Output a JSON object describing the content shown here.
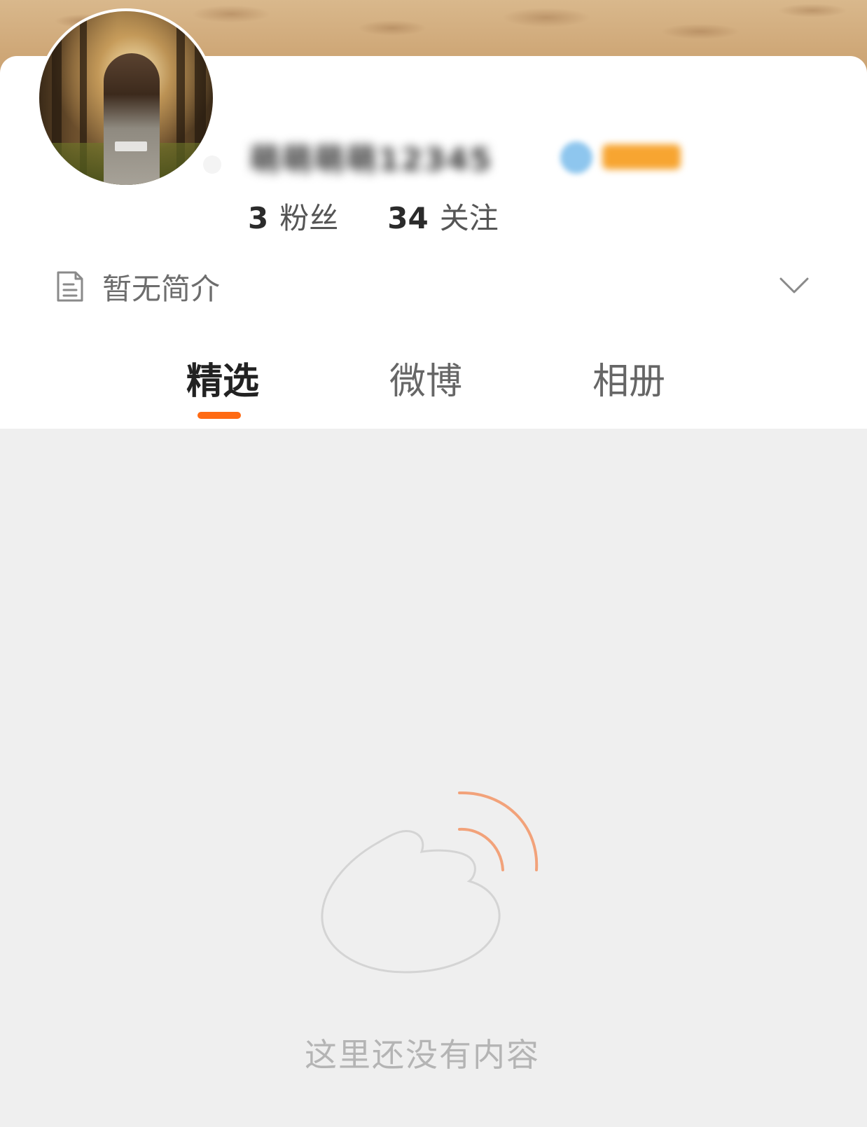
{
  "profile": {
    "username": "萌萌萌萌12345",
    "followers_count": "3",
    "followers_label": "粉丝",
    "following_count": "34",
    "following_label": "关注",
    "bio": "暂无简介"
  },
  "tabs": [
    {
      "label": "精选",
      "active": true
    },
    {
      "label": "微博",
      "active": false
    },
    {
      "label": "相册",
      "active": false
    }
  ],
  "empty_state": {
    "message": "这里还没有内容"
  },
  "icons": {
    "bio": "document-icon",
    "expand": "chevron-down-icon",
    "empty": "weibo-logo-icon"
  },
  "colors": {
    "accent": "#ff6a13",
    "empty_arcs": "#f2a27a",
    "page_background": "#efefef"
  }
}
